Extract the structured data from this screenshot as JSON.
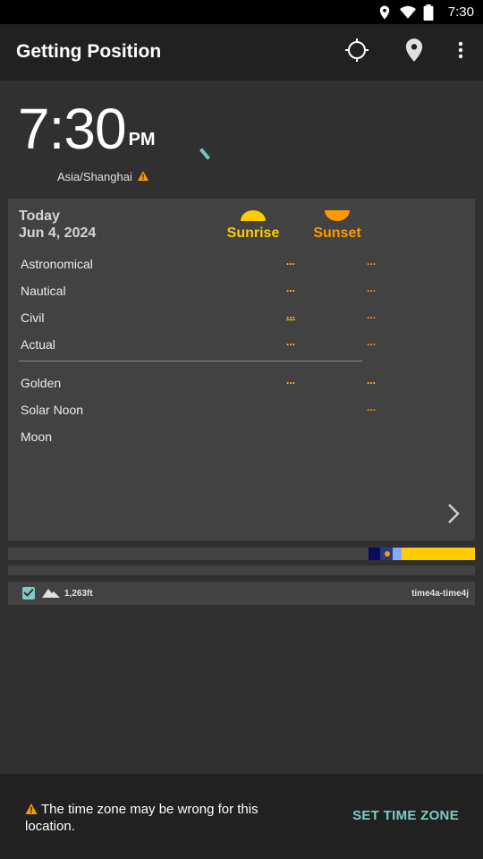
{
  "status_bar": {
    "time": "7:30",
    "icons": [
      "location-icon",
      "wifi-icon",
      "battery-icon"
    ]
  },
  "app_bar": {
    "title": "Getting Position",
    "actions": [
      "crosshair-icon",
      "map-pin-icon",
      "more-vert-icon"
    ]
  },
  "clock": {
    "time": "7:30",
    "ampm": "PM",
    "timezone": "Asia/Shanghai"
  },
  "card": {
    "today_label": "Today",
    "date": "Jun 4, 2024",
    "sunrise_label": "Sunrise",
    "sunset_label": "Sunset",
    "rows": [
      {
        "name": "Astronomical",
        "sunrise": "...",
        "sunset": "..."
      },
      {
        "name": "Nautical",
        "sunrise": "...",
        "sunset": "..."
      },
      {
        "name": "Civil",
        "sunrise": "...",
        "sunset": "..."
      },
      {
        "name": "Actual",
        "sunrise": "...",
        "sunset": "..."
      }
    ],
    "rows2": [
      {
        "name": "Golden",
        "sunrise": "...",
        "sunset": "..."
      },
      {
        "name": "Solar Noon",
        "sunrise": "",
        "sunset": "..."
      },
      {
        "name": "Moon",
        "sunrise": "",
        "sunset": ""
      }
    ]
  },
  "info": {
    "altitude": "1,263ft",
    "source": "time4a-time4j"
  },
  "snackbar": {
    "message": "The time zone may be wrong for this location.",
    "action": "SET TIME ZONE"
  },
  "colors": {
    "accent": "#80cbc4",
    "sunrise": "#ffcc00",
    "sunset": "#ff9900",
    "warning": "#ff9900",
    "night": "#0b0b5e",
    "twilight": "#82aaff",
    "day": "#ffcc00"
  }
}
